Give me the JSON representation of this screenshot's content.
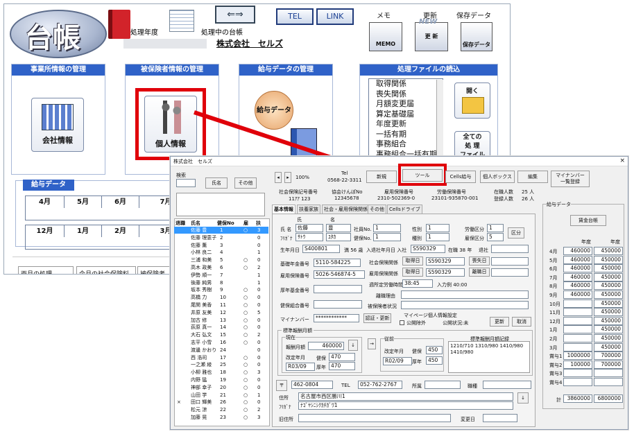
{
  "top": {
    "logo_text": "台帳",
    "fiscal_year_label": "処理年度",
    "current_ledger_label": "処理中の台帳",
    "company_name": "株式会社　セルズ",
    "tel_label": "TEL",
    "link_label": "LINK",
    "memo_label": "メモ",
    "memo_icon": "MEMO",
    "update_label": "更新",
    "update_icon": "更 新",
    "new_tag": "NEW",
    "salary_save_label": "保存データ",
    "salary_save_icon": "保存データ"
  },
  "panels": {
    "office": {
      "title": "事業所情報の管理",
      "icon_label": "会社情報"
    },
    "insured": {
      "title": "被保険者情報の管理",
      "icon_label": "個人情報"
    },
    "salary": {
      "title": "給与データの管理",
      "icon_label": "給与データ"
    },
    "files": {
      "title": "処理ファイルの読込",
      "open_label": "開く",
      "all_files_label": "全ての\n処 理\nファイル",
      "items": [
        "取得関係",
        "喪失関係",
        "月額変更届",
        "算定基礎届",
        "年度更新",
        "一括有期",
        "事務組合",
        "事務組合一括有期"
      ]
    }
  },
  "salary_data": {
    "title": "給与データ",
    "months_row1": [
      "4月",
      "5月",
      "6月",
      "7月"
    ],
    "months_row2": [
      "12月",
      "1月",
      "2月",
      "3月"
    ]
  },
  "bottom_buttons": [
    "両月の処理",
    "今月の社会保険料",
    "被保険者"
  ],
  "front": {
    "title": "株式会社　セルズ",
    "close": "×",
    "search_label": "検索",
    "name_btn": "氏名",
    "other_btn": "その他",
    "zoom": "100%",
    "tel_label": "Tel",
    "tel_value": "0568-22-3311",
    "new_btn": "新規",
    "tool_btn": "ツール",
    "cells_salary_btn": "Cells給与",
    "personal_box_btn": "個人ボックス",
    "edit_btn": "編集",
    "mynumber_btn": "マイナンバー\n一覧登録",
    "social_no_label": "社会保険記号番号",
    "social_no": "11ｱｱ 123",
    "kyokai_label": "協会けんぽNo",
    "kyokai_no": "12345678",
    "emp_ins_label": "雇用保険番号",
    "emp_ins_no": "2310-502369-0",
    "labor_label": "労働保険番号",
    "labor_no": "23101-935870-001",
    "enrolled_label": "在職人数",
    "enrolled": "25 人",
    "registered_label": "登録人数",
    "registered": "26 人",
    "list_headers": [
      "退職",
      "氏名",
      "健保No",
      "雇",
      "扶"
    ],
    "employees": [
      [
        "",
        "佐藤 豊",
        "1",
        "○",
        "3"
      ],
      [
        "",
        "佐藤 理恵子",
        "2",
        "",
        "0"
      ],
      [
        "",
        "佐藤 薫",
        "3",
        "",
        "0"
      ],
      [
        "",
        "小林 良二",
        "4",
        "",
        "1"
      ],
      [
        "",
        "三浦 和美",
        "5",
        "○",
        "0"
      ],
      [
        "",
        "高木 政美",
        "6",
        "○",
        "2"
      ],
      [
        "",
        "伊勢 順一",
        "7",
        "",
        "1"
      ],
      [
        "",
        "後藤 純男",
        "8",
        "",
        "1"
      ],
      [
        "",
        "坂本 秀樹",
        "9",
        "○",
        "0"
      ],
      [
        "",
        "高橋 力",
        "10",
        "○",
        "0"
      ],
      [
        "",
        "尾関 美香",
        "11",
        "○",
        "0"
      ],
      [
        "",
        "井原 友美",
        "12",
        "○",
        "5"
      ],
      [
        "",
        "加古 修",
        "13",
        "○",
        "0"
      ],
      [
        "",
        "荻原 真一",
        "14",
        "○",
        "0"
      ],
      [
        "",
        "大石 弘文",
        "15",
        "○",
        "2"
      ],
      [
        "",
        "志平 小雪",
        "16",
        "○",
        "0"
      ],
      [
        "",
        "渡邊 かおり",
        "24",
        "",
        "0"
      ],
      [
        "",
        "西 浩司",
        "17",
        "○",
        "0"
      ],
      [
        "",
        "一之瀬 綾",
        "25",
        "○",
        "0"
      ],
      [
        "",
        "小柳 雅也",
        "18",
        "○",
        "3"
      ],
      [
        "",
        "内野 猛",
        "19",
        "○",
        "0"
      ],
      [
        "",
        "神部 幸子",
        "20",
        "○",
        "0"
      ],
      [
        "",
        "山田 学",
        "21",
        "○",
        "1"
      ],
      [
        "×",
        "田口 輝美",
        "26",
        "○",
        "0"
      ],
      [
        "",
        "松元 涼",
        "22",
        "○",
        "2"
      ],
      [
        "",
        "加藤 晃",
        "23",
        "○",
        "3"
      ]
    ],
    "tabs": [
      "基本情報",
      "扶養家族",
      "社会・雇用保険関係",
      "その他",
      "Cellsドライブ"
    ],
    "name_label": "氏 名",
    "kana_label": "ﾌﾘｶﾞﾅ",
    "sei_label": "氏",
    "mei_label": "名",
    "sei": "佐藤",
    "mei": "豊",
    "sei_kana": "ｻﾄｳ",
    "mei_kana": "ﾕﾀｶ",
    "staff_no_label": "社員No.",
    "staff_no": "1",
    "health_no_label": "健保No.",
    "health_no": "1",
    "gender_label": "性別",
    "gender": "1",
    "kind_label": "種別",
    "kind": "1",
    "labor_class_label": "労働区分",
    "labor_class": "1",
    "emp_class_label": "雇保区分",
    "emp_class": "5",
    "class_btn": "区分",
    "birth_label": "生年月日",
    "birth": "S400801",
    "age_label": "満 56 歳",
    "join_label": "入退社年月日 入社",
    "join": "S590329",
    "tenure": "在職 38 年",
    "leave_label": "退社",
    "pension_label": "基礎年金番号",
    "pension": "5110-584225",
    "social_rel_label": "社会保険関係",
    "acq_btn": "取得日",
    "social_acq": "S590329",
    "loss_btn": "喪失日",
    "emp_rel_label": "雇用保険関係",
    "emp_acq": "S590329",
    "sep_btn": "離職日",
    "emp_no_label": "雇用保険番号",
    "emp_no": "5026-546874-5",
    "hours_label": "週所定労働時間",
    "hours": "38:45",
    "entry_label": "入力例 40:00",
    "kikin_label": "厚年基金番号",
    "reason_label": "離職理由",
    "kumiai_label": "健保組合番号",
    "status_label": "被保険者状況",
    "mynumber_label": "マイナンバー",
    "mynumber": "************",
    "auth_btn": "認証・更新",
    "mp_label": "マイページ個人情報設定",
    "public_label": "公開除外",
    "public_status": "公開状況:未",
    "renew_btn": "更新",
    "cancel_btn": "取消",
    "std_label": "標準報酬月額",
    "current_label": "現在",
    "std_monthly_label": "報酬月額",
    "std_monthly": "460000",
    "revision_label": "改定年月",
    "revision": "R03/09",
    "kenpo_label": "健保",
    "kenpo": "470",
    "kounen_label": "厚年",
    "kounen": "470",
    "prev_label": "従前",
    "prev_revision": "R02/09",
    "prev_kenpo": "450",
    "prev_kounen": "450",
    "record_label": "標準報酬月額記録",
    "record": "1210/710 1310/980 1410/980\n1410/980",
    "zip_mark": "〒",
    "zip": "462-0804",
    "tel2_label": "TEL",
    "tel2": "052-762-2767",
    "affil_label": "所属",
    "job_label": "職種",
    "addr_label": "住所",
    "addr": "名古屋市西区勝川1",
    "addr_kana_label": "ﾌﾘｶﾞﾅ",
    "addr_kana": "ﾅｺﾞﾔｼﾆｼｸｶﾁｶﾞﾜ1",
    "old_addr_label": "旧住所",
    "change_date_label": "変更日",
    "salary_frame_label": "給与データ",
    "wage_ledger_btn": "賃金台帳",
    "year_label": "年度",
    "salary_rows": [
      [
        "4月",
        "460000",
        "450000"
      ],
      [
        "5月",
        "460000",
        "450000"
      ],
      [
        "6月",
        "460000",
        "450000"
      ],
      [
        "7月",
        "460000",
        "450000"
      ],
      [
        "8月",
        "460000",
        "450000"
      ],
      [
        "9月",
        "460000",
        "450000"
      ],
      [
        "10月",
        "",
        "450000"
      ],
      [
        "11月",
        "",
        "450000"
      ],
      [
        "12月",
        "",
        "450000"
      ],
      [
        "1月",
        "",
        "450000"
      ],
      [
        "2月",
        "",
        "450000"
      ],
      [
        "3月",
        "",
        "450000"
      ],
      [
        "賞与1",
        "1000000",
        "700000"
      ],
      [
        "賞与2",
        "100000",
        "700000"
      ],
      [
        "賞与3",
        "",
        ""
      ],
      [
        "賞与4",
        "",
        ""
      ]
    ],
    "total_label": "計",
    "total1": "3860000",
    "total2": "6800000"
  },
  "colors": {
    "accent": "#2f62c8",
    "highlight": "#e0000a",
    "selected_row": "#3399ff"
  }
}
